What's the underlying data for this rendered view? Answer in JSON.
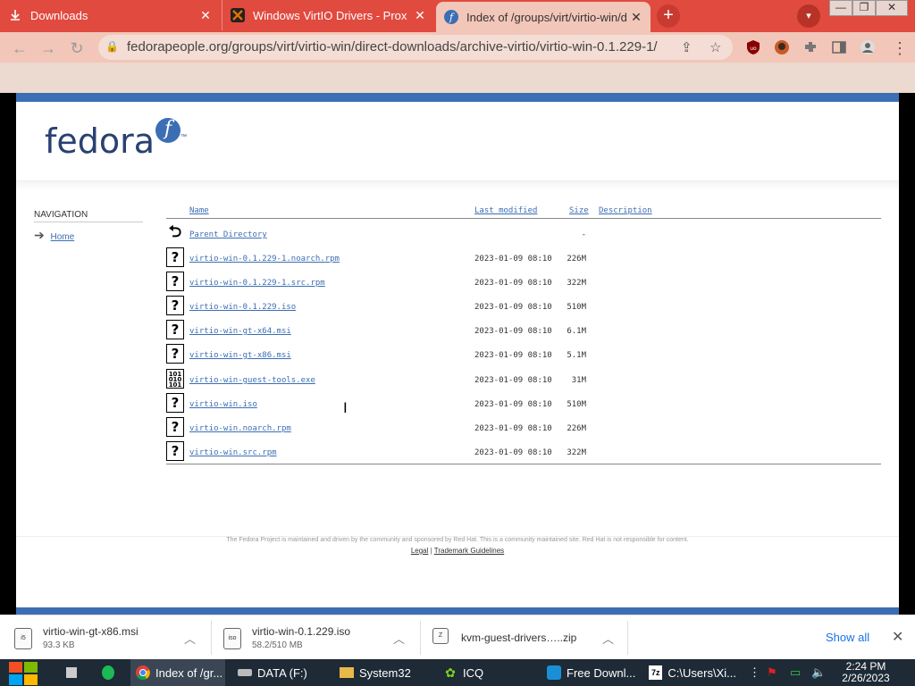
{
  "tabs": [
    {
      "label": "Downloads",
      "close": "✕"
    },
    {
      "label": "Windows VirtIO Drivers - Prox",
      "close": "✕"
    },
    {
      "label": "Index of /groups/virt/virtio-win/d",
      "close": "✕"
    }
  ],
  "new_tab": "+",
  "tab_search": "▾",
  "window_controls": [
    "—",
    "❐",
    "✕"
  ],
  "address_bar": {
    "url": "fedorapeople.org/groups/virt/virtio-win/direct-downloads/archive-virtio/virtio-win-0.1.229-1/"
  },
  "logo": {
    "text": "fedora",
    "badge": "f",
    "tm": "™"
  },
  "navigation": {
    "heading": "NAVIGATION",
    "home": "Home"
  },
  "listing": {
    "headers": {
      "name": "Name",
      "modified": "Last modified",
      "size": "Size",
      "description": "Description"
    },
    "parent": {
      "name": "Parent Directory",
      "size": "-"
    },
    "files": [
      {
        "name": "virtio-win-0.1.229-1.noarch.rpm",
        "modified": "2023-01-09 08:10",
        "size": "226M",
        "icon": "?"
      },
      {
        "name": "virtio-win-0.1.229-1.src.rpm",
        "modified": "2023-01-09 08:10",
        "size": "322M",
        "icon": "?"
      },
      {
        "name": "virtio-win-0.1.229.iso",
        "modified": "2023-01-09 08:10",
        "size": "510M",
        "icon": "?"
      },
      {
        "name": "virtio-win-gt-x64.msi",
        "modified": "2023-01-09 08:10",
        "size": "6.1M",
        "icon": "?"
      },
      {
        "name": "virtio-win-gt-x86.msi",
        "modified": "2023-01-09 08:10",
        "size": "5.1M",
        "icon": "?"
      },
      {
        "name": "virtio-win-guest-tools.exe",
        "modified": "2023-01-09 08:10",
        "size": "31M",
        "icon": "binary"
      },
      {
        "name": "virtio-win.iso",
        "modified": "2023-01-09 08:10",
        "size": "510M",
        "icon": "?"
      },
      {
        "name": "virtio-win.noarch.rpm",
        "modified": "2023-01-09 08:10",
        "size": "226M",
        "icon": "?"
      },
      {
        "name": "virtio-win.src.rpm",
        "modified": "2023-01-09 08:10",
        "size": "322M",
        "icon": "?"
      }
    ]
  },
  "footer": {
    "note": "The Fedora Project is maintained and driven by the community and sponsored by Red Hat. This is a community maintained site. Red Hat is not responsible for content.",
    "legal": "Legal",
    "separator": "|",
    "trademark": "Trademark Guidelines"
  },
  "downloads": [
    {
      "name": "virtio-win-gt-x86.msi",
      "sub": "93.3 KB",
      "icon_text": "i5"
    },
    {
      "name": "virtio-win-0.1.229.iso",
      "sub": "58.2/510 MB",
      "icon_text": "iso"
    },
    {
      "name": "kvm-guest-drivers…..zip",
      "sub": "",
      "icon_text": "Z"
    }
  ],
  "show_all": "Show all",
  "taskbar": {
    "items": [
      {
        "label": "Index of /gr..."
      },
      {
        "label": "DATA (F:)"
      },
      {
        "label": "System32"
      },
      {
        "label": "ICQ"
      },
      {
        "label": "Free Downl..."
      },
      {
        "label": "C:\\Users\\Xi..."
      }
    ],
    "time": "2:24 PM",
    "date": "2/26/2023"
  },
  "colors": {
    "fedora_blue": "#3c6eb4",
    "tab_red": "#e14a3f"
  }
}
